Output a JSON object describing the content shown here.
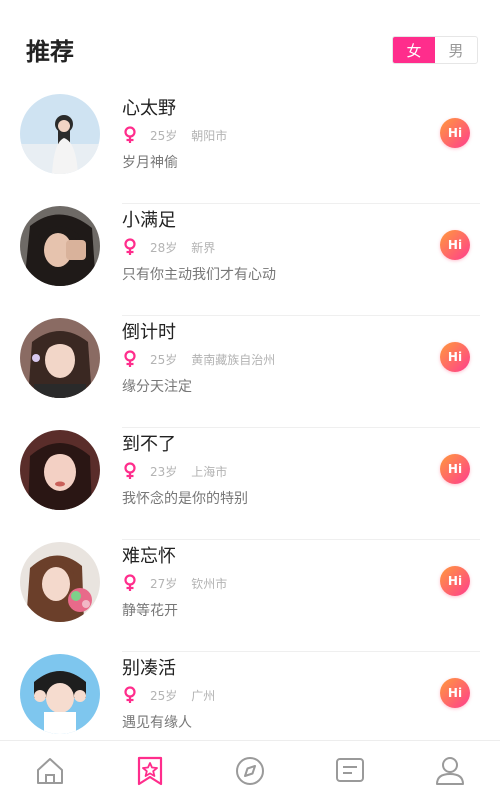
{
  "header": {
    "title": "推荐",
    "gender_toggle": {
      "female": "女",
      "male": "男",
      "selected": "女"
    }
  },
  "colors": {
    "accent": "#ff2d8c",
    "hi_start": "#ff9a3c",
    "hi_end": "#ff3d8e"
  },
  "users": [
    {
      "name": "心太野",
      "age": "25岁",
      "location": "朝阳市",
      "bio": "岁月神偷",
      "hi": "Hi"
    },
    {
      "name": "小满足",
      "age": "28岁",
      "location": "新界",
      "bio": "只有你主动我们才有心动",
      "hi": "Hi"
    },
    {
      "name": "倒计时",
      "age": "25岁",
      "location": "黄南藏族自治州",
      "bio": "缘分天注定",
      "hi": "Hi"
    },
    {
      "name": "到不了",
      "age": "23岁",
      "location": "上海市",
      "bio": "我怀念的是你的特别",
      "hi": "Hi"
    },
    {
      "name": "难忘怀",
      "age": "27岁",
      "location": "钦州市",
      "bio": "静等花开",
      "hi": "Hi"
    },
    {
      "name": "别凑活",
      "age": "25岁",
      "location": "广州",
      "bio": "遇见有缘人",
      "hi": "Hi"
    }
  ],
  "tabbar": {
    "items": [
      "home-icon",
      "recommend-icon",
      "discover-icon",
      "messages-icon",
      "profile-icon"
    ],
    "selected": "recommend-icon"
  }
}
